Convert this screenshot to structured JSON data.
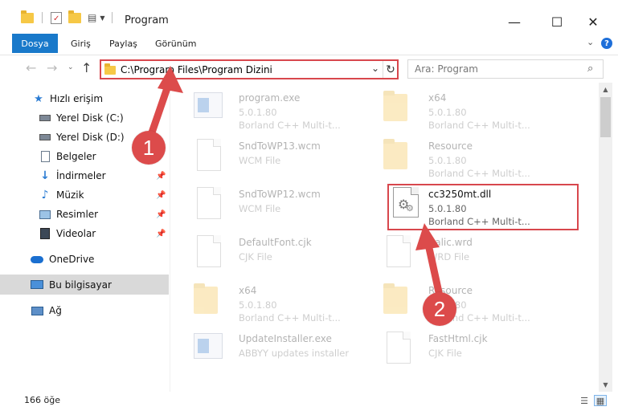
{
  "window": {
    "title": "Program",
    "minimize_glyph": "—",
    "maximize_glyph": "☐",
    "close_glyph": "✕"
  },
  "ribbon": {
    "tabs": [
      {
        "label": "Dosya"
      },
      {
        "label": "Giriş"
      },
      {
        "label": "Paylaş"
      },
      {
        "label": "Görünüm"
      }
    ],
    "help_glyph": "?"
  },
  "nav": {
    "address": "C:\\Program Files\\Program Dizini",
    "search_placeholder": "Ara: Program"
  },
  "sidebar": {
    "items": [
      {
        "label": "Hızlı erişim",
        "icon": "star-icon"
      },
      {
        "label": "Yerel Disk (C:)",
        "icon": "drive-icon"
      },
      {
        "label": "Yerel Disk (D:)",
        "icon": "drive-icon"
      },
      {
        "label": "Belgeler",
        "icon": "documents-icon"
      },
      {
        "label": "İndirmeler",
        "icon": "download-icon"
      },
      {
        "label": "Müzik",
        "icon": "music-icon"
      },
      {
        "label": "Resimler",
        "icon": "pictures-icon"
      },
      {
        "label": "Videolar",
        "icon": "videos-icon"
      },
      {
        "label": "OneDrive",
        "icon": "cloud-icon"
      },
      {
        "label": "Bu bilgisayar",
        "icon": "computer-icon"
      },
      {
        "label": "Ağ",
        "icon": "network-icon"
      }
    ]
  },
  "files": [
    {
      "name": "program.exe",
      "line2": "5.0.1.80",
      "line3": "Borland C++ Multi-t...",
      "icon": "exe-icon"
    },
    {
      "name": "x64",
      "line2": "5.0.1.80",
      "line3": "Borland C++ Multi-t...",
      "icon": "folder-icon"
    },
    {
      "name": "SndToWP13.wcm",
      "line2": "WCM File",
      "line3": "",
      "icon": "document-icon"
    },
    {
      "name": "Resource",
      "line2": "5.0.1.80",
      "line3": "Borland C++ Multi-t...",
      "icon": "folder-icon"
    },
    {
      "name": "SndToWP12.wcm",
      "line2": "WCM File",
      "line3": "",
      "icon": "document-icon"
    },
    {
      "name": "cc3250mt.dll",
      "line2": "5.0.1.80",
      "line3": "Borland C++ Multi-t...",
      "icon": "dll-gear-icon"
    },
    {
      "name": "DefaultFont.cjk",
      "line2": "CJK File",
      "line3": "",
      "icon": "document-icon"
    },
    {
      "name": "Italic.wrd",
      "line2": "WRD File",
      "line3": "",
      "icon": "document-icon"
    },
    {
      "name": "x64",
      "line2": "5.0.1.80",
      "line3": "Borland C++ Multi-t...",
      "icon": "folder-icon"
    },
    {
      "name": "Resource",
      "line2": "5.0.1.80",
      "line3": "Borland C++ Multi-t...",
      "icon": "folder-icon"
    },
    {
      "name": "UpdateInstaller.exe",
      "line2": "ABBYY updates installer",
      "line3": "",
      "icon": "installer-icon"
    },
    {
      "name": "FastHtml.cjk",
      "line2": "CJK File",
      "line3": "",
      "icon": "document-icon"
    }
  ],
  "status": {
    "count": "166 öğe"
  },
  "annotations": {
    "step1": "1",
    "step2": "2",
    "accent_color": "#d8474d"
  }
}
